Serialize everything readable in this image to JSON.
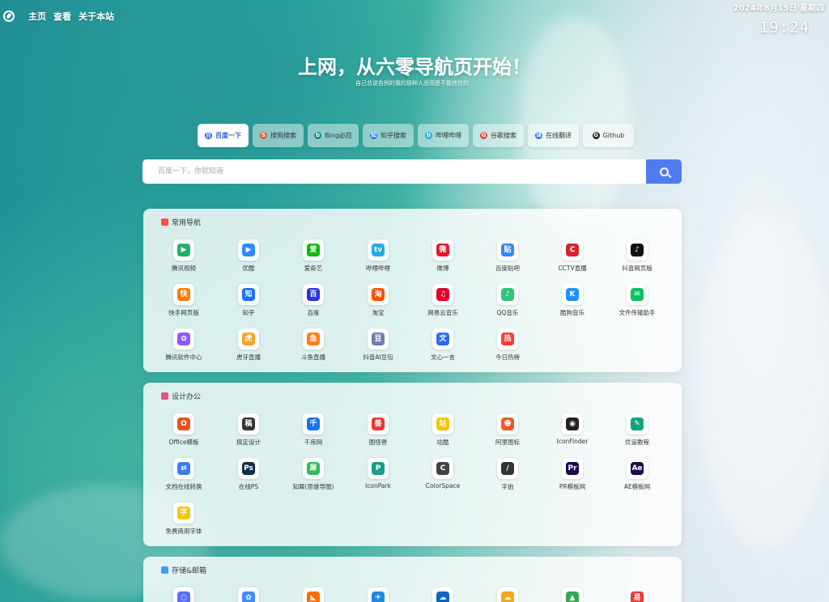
{
  "nav": {
    "links": [
      "主页",
      "查看",
      "关于本站"
    ]
  },
  "clock": {
    "date": "2024年8月15日 星期四",
    "time": "19:24"
  },
  "hero": {
    "title": "上网，从六零导航页开始！",
    "subtitle": "自己总说告别的我的那种人总而是不能信任的"
  },
  "engines": [
    {
      "label": "百度一下",
      "icon": "baidu-icon",
      "color": "#2a5bd7",
      "glyph": "百",
      "active": true
    },
    {
      "label": "搜狗搜索",
      "icon": "sogou-icon",
      "color": "#e4572e",
      "glyph": "S",
      "active": false
    },
    {
      "label": "Bing必应",
      "icon": "bing-icon",
      "color": "#0f8f8a",
      "glyph": "b",
      "active": false
    },
    {
      "label": "知乎搜索",
      "icon": "zhihu-icon",
      "color": "#1772f6",
      "glyph": "知",
      "active": false
    },
    {
      "label": "哔哩哔哩",
      "icon": "bilibili-icon",
      "color": "#23ade5",
      "glyph": "b",
      "active": false
    },
    {
      "label": "谷歌搜索",
      "icon": "google-icon",
      "color": "#ea4335",
      "glyph": "G",
      "active": false
    },
    {
      "label": "在线翻译",
      "icon": "translate-icon",
      "color": "#2a6fd6",
      "glyph": "译",
      "active": false
    },
    {
      "label": "Github",
      "icon": "github-icon",
      "color": "#222222",
      "glyph": "G",
      "active": false
    }
  ],
  "search": {
    "placeholder": "百度一下，你就知道"
  },
  "sections": [
    {
      "title": "常用导航",
      "icon": "fire-icon",
      "icon_color": "#ff4d3d",
      "items": [
        {
          "label": "腾讯视频",
          "icon": "tencent-video-icon",
          "color": "#20b26a",
          "glyph": "▶"
        },
        {
          "label": "优酷",
          "icon": "youku-icon",
          "color": "#2b8cff",
          "glyph": "▶"
        },
        {
          "label": "爱奇艺",
          "icon": "iqiyi-icon",
          "color": "#00be06",
          "glyph": "爱"
        },
        {
          "label": "哔哩哔哩",
          "icon": "bilibili-icon",
          "color": "#23ade5",
          "glyph": "tv"
        },
        {
          "label": "微博",
          "icon": "weibo-icon",
          "color": "#e6162d",
          "glyph": "微"
        },
        {
          "label": "百度贴吧",
          "icon": "tieba-icon",
          "color": "#3385ff",
          "glyph": "贴"
        },
        {
          "label": "CCTV直播",
          "icon": "cctv-icon",
          "color": "#d7242a",
          "glyph": "C"
        },
        {
          "label": "抖音网页版",
          "icon": "douyin-icon",
          "color": "#111111",
          "glyph": "♪"
        },
        {
          "label": "快手网页版",
          "icon": "kuaishou-icon",
          "color": "#ff7a00",
          "glyph": "快"
        },
        {
          "label": "知乎",
          "icon": "zhihu-icon",
          "color": "#1772f6",
          "glyph": "知"
        },
        {
          "label": "百度",
          "icon": "baidu-paw-icon",
          "color": "#2932e1",
          "glyph": "百"
        },
        {
          "label": "淘宝",
          "icon": "taobao-icon",
          "color": "#ff5000",
          "glyph": "淘"
        },
        {
          "label": "网易云音乐",
          "icon": "netease-music-icon",
          "color": "#e60026",
          "glyph": "♫"
        },
        {
          "label": "QQ音乐",
          "icon": "qq-music-icon",
          "color": "#31c27c",
          "glyph": "♪"
        },
        {
          "label": "酷狗音乐",
          "icon": "kugou-icon",
          "color": "#1f8fff",
          "glyph": "K"
        },
        {
          "label": "文件传输助手",
          "icon": "wechat-icon",
          "color": "#07c160",
          "glyph": "✉"
        },
        {
          "label": "腾讯软件中心",
          "icon": "tencent-software-icon",
          "color": "#8a5cf5",
          "glyph": "✿"
        },
        {
          "label": "虎牙直播",
          "icon": "huya-icon",
          "color": "#f5a623",
          "glyph": "虎"
        },
        {
          "label": "斗鱼直播",
          "icon": "douyu-icon",
          "color": "#ff7d14",
          "glyph": "鱼"
        },
        {
          "label": "抖音AI豆包",
          "icon": "doubao-icon",
          "color": "#6b7fa8",
          "glyph": "豆"
        },
        {
          "label": "文心一言",
          "icon": "wenxin-icon",
          "color": "#2e6bf0",
          "glyph": "文"
        },
        {
          "label": "今日热榜",
          "icon": "hot-list-icon",
          "color": "#ff3b30",
          "glyph": "热"
        }
      ]
    },
    {
      "title": "设计办公",
      "icon": "design-icon",
      "icon_color": "#e8508a",
      "items": [
        {
          "label": "Office模板",
          "icon": "office-icon",
          "color": "#e8531f",
          "glyph": "O"
        },
        {
          "label": "搞定设计",
          "icon": "gaoding-icon",
          "color": "#333333",
          "glyph": "稿"
        },
        {
          "label": "千库网",
          "icon": "qianku-icon",
          "color": "#1a73e8",
          "glyph": "千"
        },
        {
          "label": "图怪兽",
          "icon": "tuguaishou-icon",
          "color": "#e53935",
          "glyph": "兽"
        },
        {
          "label": "站酷",
          "icon": "zcool-icon",
          "color": "#f5c400",
          "glyph": "站"
        },
        {
          "label": "阿里图标",
          "icon": "iconfont-icon",
          "color": "#f05a28",
          "glyph": "☻"
        },
        {
          "label": "IconFinder",
          "icon": "iconfinder-icon",
          "color": "#222222",
          "glyph": "◉"
        },
        {
          "label": "优设教程",
          "icon": "uisdc-icon",
          "color": "#10a37f",
          "glyph": "✎"
        },
        {
          "label": "文档在线转换",
          "icon": "doc-convert-icon",
          "color": "#3d7bf5",
          "glyph": "⇄"
        },
        {
          "label": "在线PS",
          "icon": "photoshop-icon",
          "color": "#0f2d4f",
          "glyph": "Ps"
        },
        {
          "label": "知犀(思维导图)",
          "icon": "zhixi-icon",
          "color": "#2dbd5a",
          "glyph": "犀"
        },
        {
          "label": "IconPark",
          "icon": "iconpark-icon",
          "color": "#16a085",
          "glyph": "P"
        },
        {
          "label": "ColorSpace",
          "icon": "colorspace-icon",
          "color": "#444444",
          "glyph": "C"
        },
        {
          "label": "字由",
          "icon": "ziyou-icon",
          "color": "#333333",
          "glyph": "/"
        },
        {
          "label": "PR模板网",
          "icon": "premiere-icon",
          "color": "#1b0a4d",
          "glyph": "Pr"
        },
        {
          "label": "AE模板网",
          "icon": "aftereffects-icon",
          "color": "#1b0a4d",
          "glyph": "Ae"
        },
        {
          "label": "免费商用字体",
          "icon": "font-icon",
          "color": "#f5c400",
          "glyph": "字"
        }
      ]
    },
    {
      "title": "存储&邮箱",
      "icon": "cloud-icon",
      "icon_color": "#3aa0f5",
      "items": [
        {
          "label": "",
          "icon": "storage-1-icon",
          "color": "#5b6cff",
          "glyph": "○"
        },
        {
          "label": "",
          "icon": "storage-2-icon",
          "color": "#3f8cff",
          "glyph": "✿"
        },
        {
          "label": "",
          "icon": "storage-3-icon",
          "color": "#ff6a00",
          "glyph": "◣"
        },
        {
          "label": "",
          "icon": "storage-4-icon",
          "color": "#1e88e5",
          "glyph": "✈"
        },
        {
          "label": "",
          "icon": "storage-5-icon",
          "color": "#0a66c2",
          "glyph": "☁"
        },
        {
          "label": "",
          "icon": "storage-6-icon",
          "color": "#f5a623",
          "glyph": "☁"
        },
        {
          "label": "",
          "icon": "storage-7-icon",
          "color": "#34a853",
          "glyph": "▲"
        },
        {
          "label": "",
          "icon": "storage-8-icon",
          "color": "#e53935",
          "glyph": "易"
        }
      ]
    }
  ]
}
